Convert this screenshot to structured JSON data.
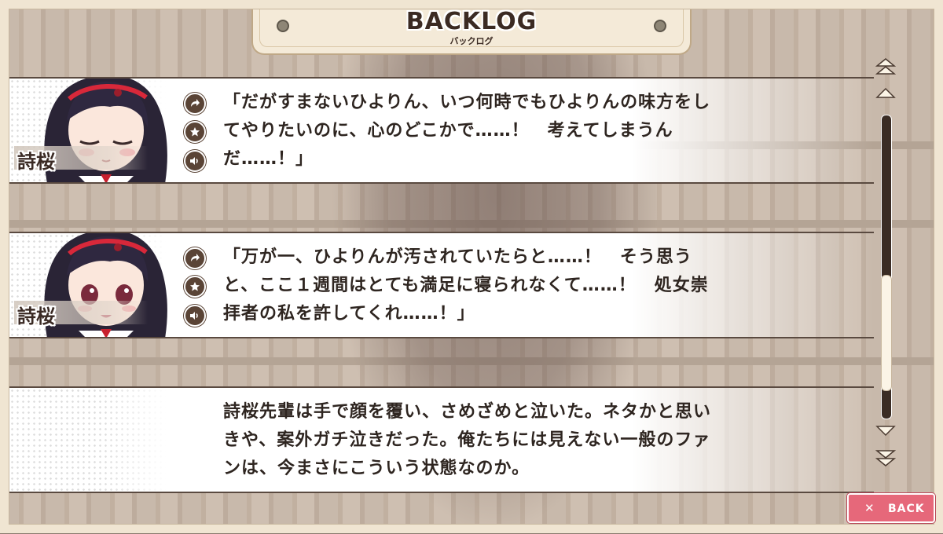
{
  "screen": {
    "title": "BACKLOG",
    "subtitle": "バックログ"
  },
  "entries": [
    {
      "speaker": "詩桜",
      "expression": "eyes-closed",
      "text": "「だがすまないひよりん、いつ何時でもひよりんの味方をしてやりたいのに、心のどこかで……！　考えてしまうんだ……！」"
    },
    {
      "speaker": "詩桜",
      "expression": "worried",
      "text": "「万が一、ひよりんが汚されていたらと……！　そう思うと、ここ１週間はとても満足に寝られなくて……！　処女崇拝者の私を許してくれ……！」"
    },
    {
      "speaker": "",
      "text": "詩桜先輩は手で顔を覆い、さめざめと泣いた。ネタかと思いきや、案外ガチ泣きだった。俺たちには見えない一般のファンは、今まさにこういう状態なのか。"
    }
  ],
  "controls": {
    "jump_icon": "arrow-jump-icon",
    "favorite_icon": "star-icon",
    "voice_icon": "speaker-icon"
  },
  "scrollbar": {
    "position": 0.85
  },
  "back_button": {
    "label": "BACK",
    "icon": "close-icon"
  },
  "colors": {
    "frame": "#f0e5d2",
    "text": "#2e2520",
    "back_button": "#e6687a",
    "control_icon": "#5a4436"
  }
}
